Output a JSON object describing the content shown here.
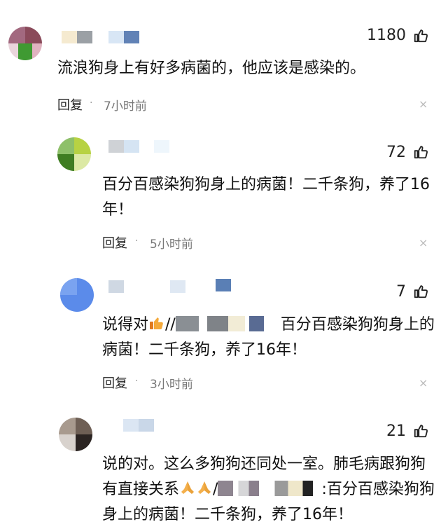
{
  "comments": [
    {
      "likes": "1180",
      "text": "流浪狗身上有好多病菌的，他应该是感染的。",
      "reply_label": "回复",
      "dot": "·",
      "time": "7小时前",
      "close": "×"
    },
    {
      "likes": "72",
      "text": "百分百感染狗狗身上的病菌！二千条狗，养了16年！",
      "reply_label": "回复",
      "dot": "·",
      "time": "5小时前",
      "close": "×"
    },
    {
      "likes": "7",
      "text_prefix": "说得对",
      "text_sep": "//",
      "text_suffix": "百分百感染狗狗身上的病菌！二千条狗，养了16年！",
      "reply_label": "回复",
      "dot": "·",
      "time": "3小时前",
      "close": "×"
    },
    {
      "likes": "21",
      "text_prefix": "说的对。这么多狗狗还同处一室。肺毛病跟狗狗有直接关系",
      "text_sep": "/",
      "text_colon": ":",
      "text_suffix": "百分百感染狗狗身上的病菌！二千条狗，养了16年！"
    }
  ],
  "icons": {
    "like": "thumbs-up-icon",
    "close": "close-icon"
  }
}
